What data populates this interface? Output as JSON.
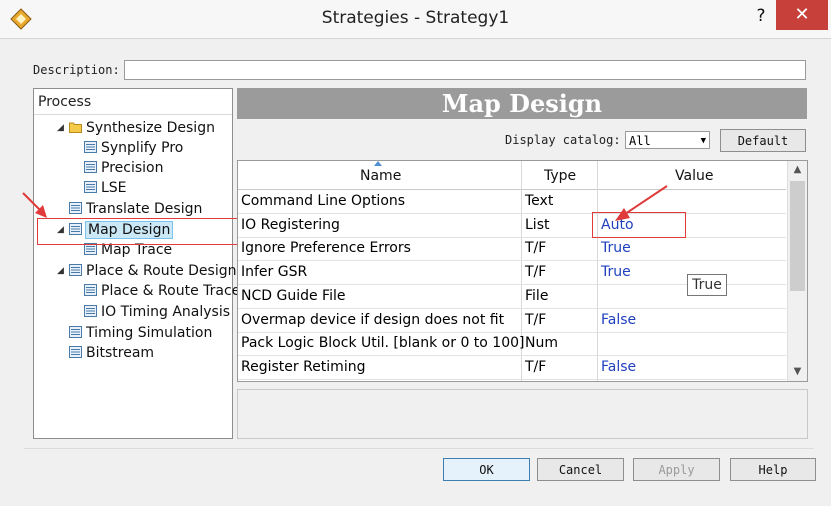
{
  "window": {
    "title": "Strategies - Strategy1",
    "help_label": "?",
    "close_label": "✕"
  },
  "description": {
    "label": "Description:",
    "value": ""
  },
  "process": {
    "header": "Process",
    "items": [
      {
        "label": "Synthesize Design",
        "icon": "folder-icon",
        "expander": "◢"
      },
      {
        "label": "Synplify Pro",
        "icon": "settings-sheet-icon"
      },
      {
        "label": "Precision",
        "icon": "settings-sheet-icon"
      },
      {
        "label": "LSE",
        "icon": "settings-sheet-icon"
      },
      {
        "label": "Translate Design",
        "icon": "settings-sheet-icon"
      },
      {
        "label": "Map Design",
        "icon": "settings-sheet-icon",
        "expander": "◢",
        "selected": true
      },
      {
        "label": "Map Trace",
        "icon": "settings-sheet-icon"
      },
      {
        "label": "Place & Route Design",
        "icon": "settings-sheet-icon",
        "expander": "◢"
      },
      {
        "label": "Place & Route Trace",
        "icon": "settings-sheet-icon"
      },
      {
        "label": "IO Timing Analysis",
        "icon": "settings-sheet-icon"
      },
      {
        "label": "Timing Simulation",
        "icon": "settings-sheet-icon"
      },
      {
        "label": "Bitstream",
        "icon": "settings-sheet-icon"
      }
    ]
  },
  "banner": {
    "title": "Map Design"
  },
  "catalog": {
    "label": "Display catalog:",
    "selected": "All",
    "default_label": "Default"
  },
  "grid": {
    "columns": [
      "Name",
      "Type",
      "Value"
    ],
    "rows": [
      {
        "name": "Command Line Options",
        "type": "Text",
        "value": ""
      },
      {
        "name": "IO Registering",
        "type": "List",
        "value": "Auto"
      },
      {
        "name": "Ignore Preference Errors",
        "type": "T/F",
        "value": "True"
      },
      {
        "name": "Infer GSR",
        "type": "T/F",
        "value": "True"
      },
      {
        "name": "NCD Guide File",
        "type": "File",
        "value": ""
      },
      {
        "name": "Overmap device if design does not fit",
        "type": "T/F",
        "value": "False"
      },
      {
        "name": "Pack Logic Block Util. [blank or 0 to 100]",
        "type": "Num",
        "value": ""
      },
      {
        "name": "Register Retiming",
        "type": "T/F",
        "value": "False"
      }
    ]
  },
  "tooltip": {
    "text": "True"
  },
  "buttons": {
    "ok": "OK",
    "cancel": "Cancel",
    "apply": "Apply",
    "help": "Help"
  },
  "colors": {
    "annotation": "#e03a3a",
    "banner": "#9b9b9b",
    "value_text": "#1f3fbf",
    "selection": "#cbe8f6"
  }
}
